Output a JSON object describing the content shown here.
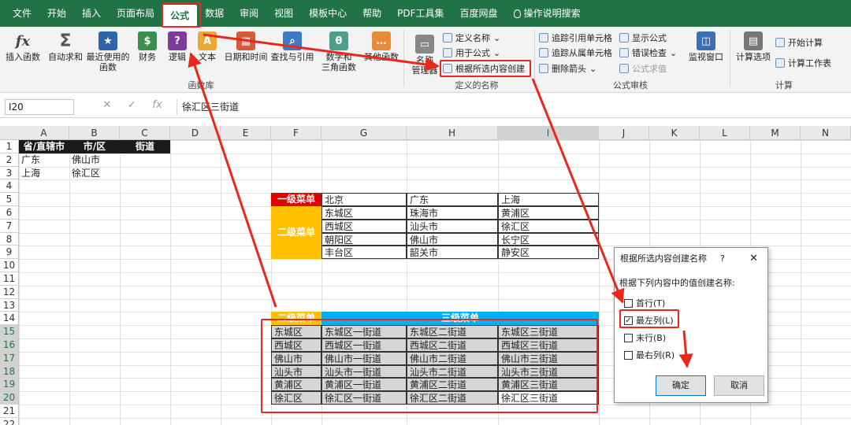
{
  "menu": {
    "tabs": [
      "文件",
      "开始",
      "插入",
      "页面布局",
      "公式",
      "数据",
      "审阅",
      "视图",
      "模板中心",
      "帮助",
      "PDF工具集",
      "百度网盘"
    ],
    "active": "公式",
    "tell": "操作说明搜索"
  },
  "ribbon": {
    "insert_function": "插入函数",
    "autosum": "自动求和",
    "recent": "最近使用的",
    "recent2": "函数",
    "finance": "财务",
    "logic": "逻辑",
    "text": "文本",
    "datetime": "日期和时间",
    "lookup": "查找与引用",
    "math": "数学和",
    "math2": "三角函数",
    "more": "其他函数",
    "group_library": "函数库",
    "name_manager": "名称",
    "name_manager2": "管理器",
    "define_name": "定义名称",
    "use_in_formula": "用于公式",
    "create_from_selection": "根据所选内容创建",
    "group_defined": "定义的名称",
    "trace_precedents": "追踪引用单元格",
    "trace_dependents": "追踪从属单元格",
    "remove_arrows": "删除箭头",
    "show_formulas": "显示公式",
    "error_checking": "错误检查",
    "evaluate_formula": "公式求值",
    "group_audit": "公式审核",
    "watch_window": "监视窗口",
    "calc_options": "计算选项",
    "calc_now": "开始计算",
    "calc_sheet": "计算工作表",
    "group_calc": "计算"
  },
  "formula_bar": {
    "name_box": "I20",
    "cancel": "✕",
    "enter": "✓",
    "fx": "fx",
    "value": "徐汇区三街道"
  },
  "columns": [
    "A",
    "B",
    "C",
    "D",
    "E",
    "F",
    "G",
    "H",
    "I",
    "J",
    "K",
    "L",
    "M",
    "N"
  ],
  "rows": [
    "1",
    "2",
    "3",
    "4",
    "5",
    "6",
    "7",
    "8",
    "9",
    "10",
    "11",
    "12",
    "13",
    "14",
    "15",
    "16",
    "17",
    "18",
    "19",
    "20",
    "21",
    "22"
  ],
  "table1": {
    "headers": [
      "省/直辖市",
      "市/区",
      "街道"
    ],
    "rows": [
      [
        "广东",
        "佛山市",
        ""
      ],
      [
        "上海",
        "徐汇区",
        ""
      ]
    ]
  },
  "table2": {
    "level1_label": "一级菜单",
    "level2_label": "二级菜单",
    "cities": [
      "北京",
      "广东",
      "上海"
    ],
    "items": [
      [
        "东城区",
        "珠海市",
        "黄浦区"
      ],
      [
        "西城区",
        "汕头市",
        "徐汇区"
      ],
      [
        "朝阳区",
        "佛山市",
        "长宁区"
      ],
      [
        "丰台区",
        "韶关市",
        "静安区"
      ]
    ]
  },
  "table3": {
    "level2_label": "二级菜单",
    "level3_label": "三级菜单",
    "rows": [
      [
        "东城区",
        "东城区一街道",
        "东城区二街道",
        "东城区三街道"
      ],
      [
        "西城区",
        "西城区一街道",
        "西城区二街道",
        "西城区三街道"
      ],
      [
        "佛山市",
        "佛山市一街道",
        "佛山市二街道",
        "佛山市三街道"
      ],
      [
        "汕头市",
        "汕头市一街道",
        "汕头市二街道",
        "汕头市三街道"
      ],
      [
        "黄浦区",
        "黄浦区一街道",
        "黄浦区二街道",
        "黄浦区三街道"
      ],
      [
        "徐汇区",
        "徐汇区一街道",
        "徐汇区二街道",
        "徐汇区三街道"
      ]
    ]
  },
  "dialog": {
    "title": "根据所选内容创建名称",
    "help": "?",
    "close": "✕",
    "prompt": "根据下列内容中的值创建名称:",
    "options": [
      {
        "label": "首行(T)",
        "checked": false
      },
      {
        "label": "最左列(L)",
        "checked": true
      },
      {
        "label": "末行(B)",
        "checked": false
      },
      {
        "label": "最右列(R)",
        "checked": false
      }
    ],
    "ok": "确定",
    "cancel": "取消"
  },
  "colors": {
    "excel_green": "#217346",
    "highlight_red": "#e8281c",
    "menu_red": "#e00000",
    "menu_yellow": "#ffc000",
    "menu_blue": "#00b0f0"
  }
}
